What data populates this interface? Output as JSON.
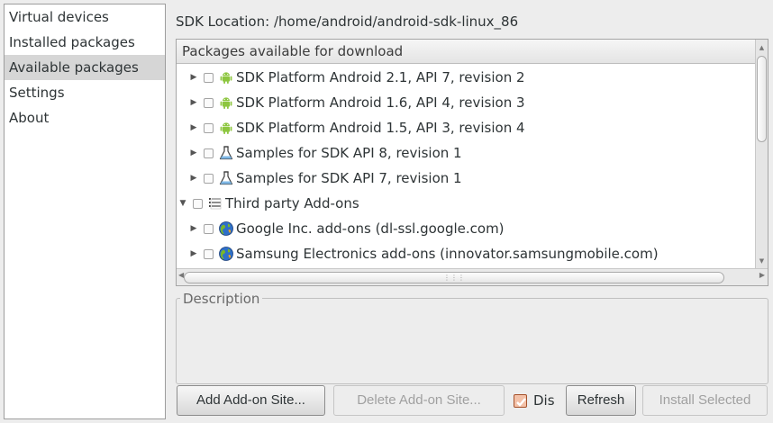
{
  "sidebar": {
    "items": [
      {
        "label": "Virtual devices",
        "selected": false
      },
      {
        "label": "Installed packages",
        "selected": false
      },
      {
        "label": "Available packages",
        "selected": true
      },
      {
        "label": "Settings",
        "selected": false
      },
      {
        "label": "About",
        "selected": false
      }
    ]
  },
  "sdk_location": "SDK Location: /home/android/android-sdk-linux_86",
  "packages": {
    "header": "Packages available for download",
    "rows": [
      {
        "label": "SDK Platform Android 2.1, API 7, revision 2",
        "icon": "android-icon",
        "level": 1,
        "expander": "collapsed",
        "checked": false
      },
      {
        "label": "SDK Platform Android 1.6, API 4, revision 3",
        "icon": "android-icon",
        "level": 1,
        "expander": "collapsed",
        "checked": false
      },
      {
        "label": "SDK Platform Android 1.5, API 3, revision 4",
        "icon": "android-icon",
        "level": 1,
        "expander": "collapsed",
        "checked": false
      },
      {
        "label": "Samples for SDK API 8, revision 1",
        "icon": "flask-icon",
        "level": 1,
        "expander": "collapsed",
        "checked": false
      },
      {
        "label": "Samples for SDK API 7, revision 1",
        "icon": "flask-icon",
        "level": 1,
        "expander": "collapsed",
        "checked": false
      },
      {
        "label": "Third party Add-ons",
        "icon": "addons-icon",
        "level": 0,
        "expander": "expanded",
        "checked": false
      },
      {
        "label": "Google Inc. add-ons (dl-ssl.google.com)",
        "icon": "globe-icon",
        "level": 1,
        "expander": "collapsed",
        "checked": false
      },
      {
        "label": "Samsung Electronics add-ons (innovator.samsungmobile.com)",
        "icon": "globe-icon",
        "level": 1,
        "expander": "collapsed",
        "checked": false
      }
    ]
  },
  "description": {
    "label": "Description"
  },
  "buttons": {
    "add_addon_site": "Add Add-on Site...",
    "delete_addon_site": "Delete Add-on Site...",
    "display_checkbox_label": "Dis",
    "display_checkbox_checked": true,
    "refresh": "Refresh",
    "install_selected": "Install Selected"
  },
  "icons": {
    "expander_collapsed": "▶",
    "expander_expanded": "▼"
  },
  "colors": {
    "android_green": "#8dc63f",
    "selected_bg": "#d6d6d6",
    "checkbox_accent": "#a6532d"
  }
}
